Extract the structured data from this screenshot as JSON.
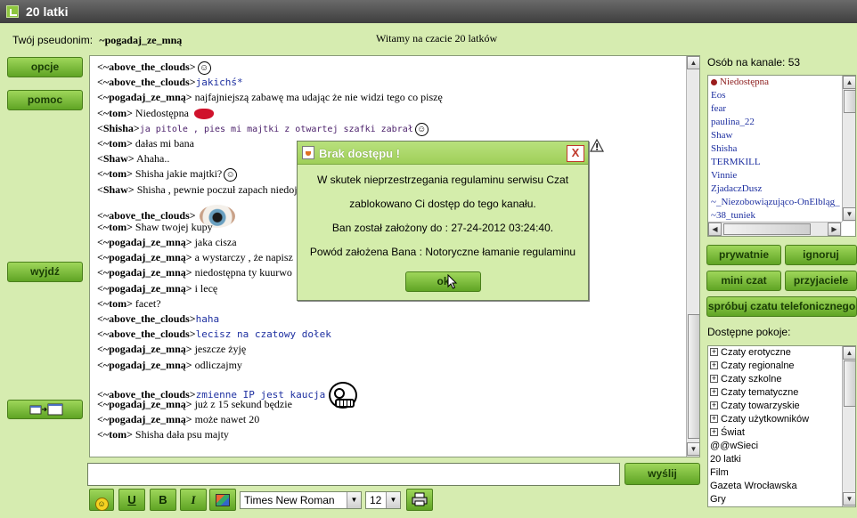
{
  "window": {
    "title": "20 latki"
  },
  "header": {
    "nick_label": "Twój pseudonim:",
    "nick_value": "~pogadaj_ze_mną",
    "welcome": "Witamy na czacie 20 latków"
  },
  "left_buttons": {
    "options": "opcje",
    "help": "pomoc",
    "exit": "wyjdź"
  },
  "chat": {
    "lines": [
      {
        "nick": "<~above_the_clouds>",
        "text": "",
        "style": "plain",
        "emoticon": "smiley"
      },
      {
        "nick": "<~above_the_clouds>",
        "text": "jakichś*",
        "style": "blue",
        "emoticon": ""
      },
      {
        "nick": "<~pogadaj_ze_mną>",
        "text": " najfajniejszą zabawę ma udając że nie widzi tego co piszę",
        "style": "plain",
        "emoticon": ""
      },
      {
        "nick": "<~tom>",
        "text": " Niedostępna",
        "style": "plain",
        "emoticon": "lips"
      },
      {
        "nick": "<Shisha>",
        "text": "ja pitole , pies mi majtki z otwartej szafki zabrał",
        "style": "purple",
        "emoticon": "smiley"
      },
      {
        "nick": "<~tom>",
        "text": " dałas mi bana",
        "style": "plain",
        "emoticon": ""
      },
      {
        "nick": "<Shaw>",
        "text": " Ahaha..",
        "style": "plain",
        "emoticon": ""
      },
      {
        "nick": "<~tom>",
        "text": " Shisha jakie majtki?",
        "style": "plain",
        "emoticon": "smiley"
      },
      {
        "nick": "<Shaw>",
        "text": " Shisha , pewnie poczuł zapach niedoj",
        "style": "plain",
        "emoticon": ""
      },
      {
        "nick": "<~above_the_clouds>",
        "text": "",
        "style": "plain",
        "emoticon": "eye"
      },
      {
        "nick": "<~tom>",
        "text": " Shaw twojej kupy",
        "style": "plain",
        "emoticon": ""
      },
      {
        "nick": "<~pogadaj_ze_mną>",
        "text": " jaka cisza",
        "style": "plain",
        "emoticon": ""
      },
      {
        "nick": "<~pogadaj_ze_mną>",
        "text": " a wystarczy , że napisz",
        "style": "plain",
        "emoticon": ""
      },
      {
        "nick": "<~pogadaj_ze_mną>",
        "text": " niedostępna ty kuurwo",
        "style": "plain",
        "emoticon": ""
      },
      {
        "nick": "<~pogadaj_ze_mną>",
        "text": " i lecę",
        "style": "plain",
        "emoticon": ""
      },
      {
        "nick": "<~tom>",
        "text": " facet?",
        "style": "plain",
        "emoticon": ""
      },
      {
        "nick": "<~above_the_clouds>",
        "text": "haha",
        "style": "blue",
        "emoticon": ""
      },
      {
        "nick": "<~above_the_clouds>",
        "text": "lecisz na czatowy dołek",
        "style": "blue",
        "emoticon": ""
      },
      {
        "nick": "<~pogadaj_ze_mną>",
        "text": " jeszcze żyję",
        "style": "plain",
        "emoticon": ""
      },
      {
        "nick": "<~pogadaj_ze_mną>",
        "text": " odliczajmy",
        "style": "plain",
        "emoticon": ""
      },
      {
        "nick": "<~above_the_clouds>",
        "text": "zmienne IP jest kaucja",
        "style": "blue",
        "emoticon": "bigface"
      },
      {
        "nick": "<~pogadaj_ze_mną>",
        "text": " już z 15 sekund będzie",
        "style": "plain",
        "emoticon": ""
      },
      {
        "nick": "<~pogadaj_ze_mną>",
        "text": " może nawet 20",
        "style": "plain",
        "emoticon": ""
      },
      {
        "nick": "<~tom>",
        "text": " Shisha dała psu majty",
        "style": "plain",
        "emoticon": ""
      }
    ]
  },
  "send_button": "wyślij",
  "toolbar": {
    "underline": "U",
    "bold": "B",
    "italic": "I",
    "font": "Times New Roman",
    "size": "12"
  },
  "right": {
    "count_label": "Osób na kanale: 53",
    "users": [
      "Niedostępna",
      "Eos",
      "fear",
      "paulina_22",
      "Shaw",
      "Shisha",
      "TERMKILL",
      "Vinnie",
      "ZjadaczDusz",
      "~_Niezobowiązująco-OnElbląg_",
      "~38_tuniek"
    ],
    "buttons": {
      "private": "prywatnie",
      "ignore": "ignoruj",
      "mini": "mini czat",
      "friends": "przyjaciele",
      "phone": "spróbuj czatu telefonicznego"
    },
    "rooms_label": "Dostępne pokoje:",
    "rooms": [
      {
        "label": "Czaty erotyczne",
        "expandable": true
      },
      {
        "label": "Czaty regionalne",
        "expandable": true
      },
      {
        "label": "Czaty szkolne",
        "expandable": true
      },
      {
        "label": "Czaty tematyczne",
        "expandable": true
      },
      {
        "label": "Czaty towarzyskie",
        "expandable": true
      },
      {
        "label": "Czaty użytkowników",
        "expandable": true
      },
      {
        "label": "Świat",
        "expandable": true
      },
      {
        "label": "@@wSieci",
        "expandable": false
      },
      {
        "label": "20 latki",
        "expandable": false
      },
      {
        "label": "Film",
        "expandable": false
      },
      {
        "label": "Gazeta Wrocławska",
        "expandable": false
      },
      {
        "label": "Gry",
        "expandable": false
      }
    ]
  },
  "dialog": {
    "title": "Brak dostępu !",
    "close": "X",
    "line1": "W skutek nieprzestrzegania regulaminu serwisu Czat",
    "line2": "zablokowano Ci dostęp do tego kanału.",
    "line3": "Ban został założony do : 27-24-2012 03:24:40.",
    "line4": "Powód założena Bana : Notoryczne łamanie regulaminu",
    "ok": "ok"
  },
  "colors": {
    "background": "#d6ecb0",
    "button_green": "#5fa424",
    "nick_offline": "#8b1a1a",
    "user_blue": "#1d2fa0",
    "close_red": "#c0392b"
  }
}
